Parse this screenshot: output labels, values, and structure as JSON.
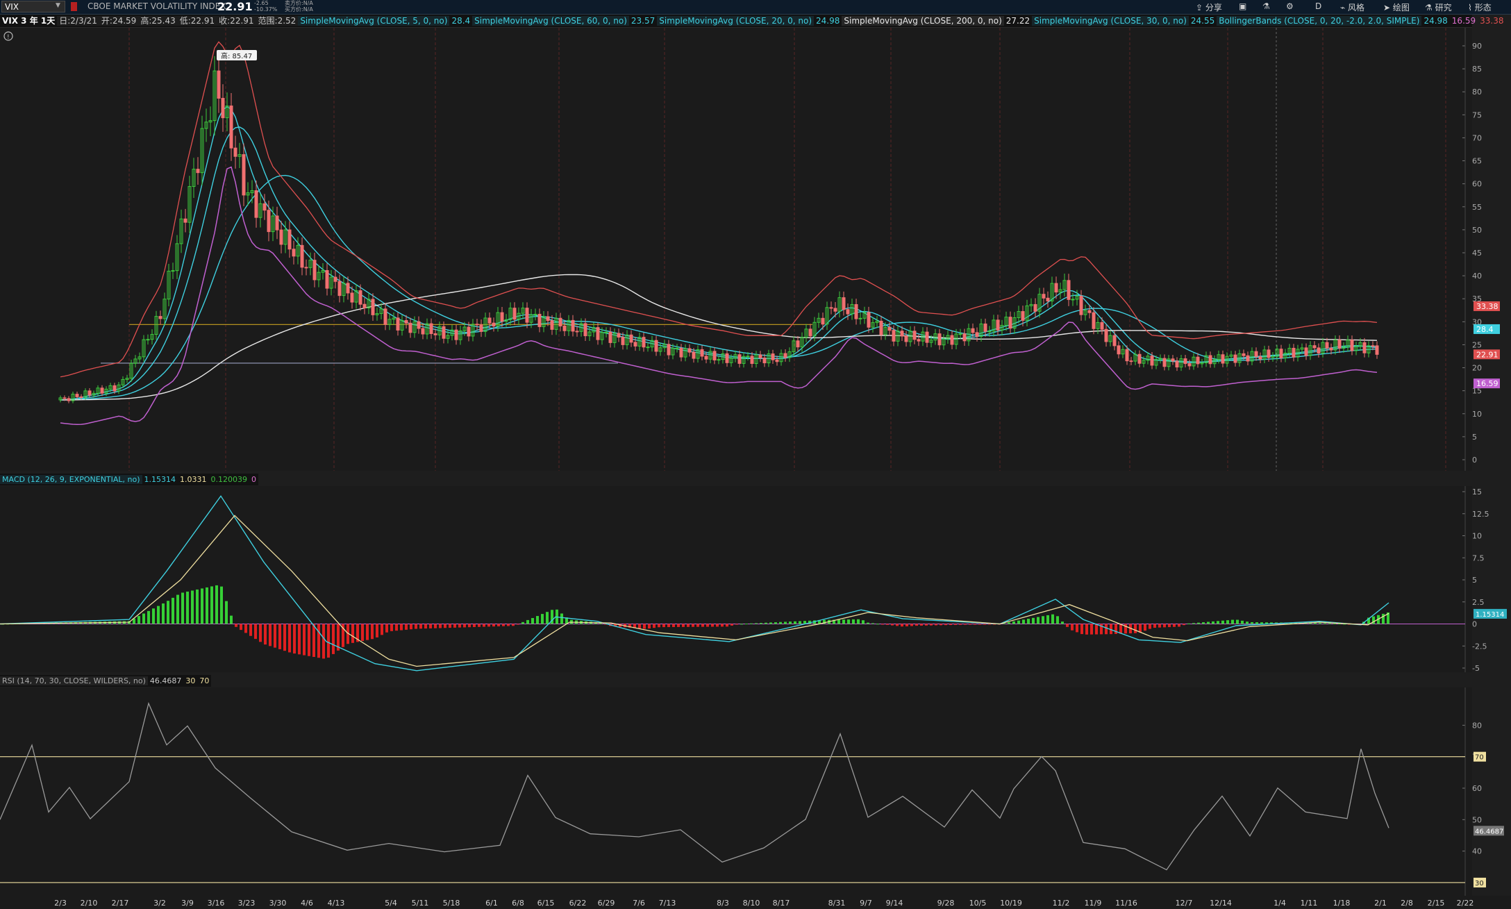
{
  "toolbar": {
    "symbol": "VIX",
    "name": "CBOE MARKET VOLATILITY INDEX",
    "last": "22.91",
    "change": "-2.65",
    "change_pct": "-10.37%",
    "bid": "卖方价:N/A",
    "ask": "买方价:N/A",
    "buttons": [
      "分享",
      "D",
      "风格",
      "绘图",
      "研究",
      "形态"
    ]
  },
  "study_header": {
    "period": "VIX 3 年 1天",
    "date": "日:2/3/21",
    "open": "开:24.59",
    "high": "高:25.43",
    "low": "低:22.91",
    "close": "收:22.91",
    "range": "范围:2.52",
    "studies": [
      {
        "label": "SimpleMovingAvg (CLOSE, 5, 0, no)",
        "value": "28.4",
        "color": "#3fd0e0"
      },
      {
        "label": "SimpleMovingAvg (CLOSE, 60, 0, no)",
        "value": "23.57",
        "color": "#3fd0e0"
      },
      {
        "label": "SimpleMovingAvg (CLOSE, 20, 0, no)",
        "value": "24.98",
        "color": "#3fd0e0"
      },
      {
        "label": "SimpleMovingAvg (CLOSE, 200, 0, no)",
        "value": "27.22",
        "color": "#e8e8e8"
      },
      {
        "label": "SimpleMovingAvg (CLOSE, 30, 0, no)",
        "value": "24.55",
        "color": "#3fd0e0"
      },
      {
        "label": "BollingerBands (CLOSE, 0, 20, -2.0, 2.0, SIMPLE)",
        "value": "24.98",
        "value2": "16.59",
        "value3": "33.38",
        "color": "#3fd0e0"
      }
    ]
  },
  "price_pane": {
    "high_marker": "高: 85.47",
    "y_ticks": [
      "90",
      "85",
      "80",
      "75",
      "70",
      "65",
      "60",
      "55",
      "50",
      "45",
      "40",
      "35",
      "30",
      "25",
      "20",
      "15",
      "10",
      "5",
      "0"
    ],
    "right_tags": [
      {
        "label": "33.38",
        "color": "#e05050"
      },
      {
        "label": "28.4",
        "color": "#3fd0e0"
      },
      {
        "label": "22.91",
        "color": "#e05050"
      },
      {
        "label": "16.59",
        "color": "#c060d0"
      }
    ]
  },
  "macd_pane": {
    "label": "MACD (12, 26, 9, EXPONENTIAL, no)",
    "value": "1.15314",
    "avg": "1.0331",
    "diff": "0.120039",
    "zero": "0",
    "y_ticks": [
      "15",
      "12.5",
      "10",
      "7.5",
      "5",
      "2.5",
      "0",
      "-2.5",
      "-5"
    ],
    "right_tag": "1.15314"
  },
  "rsi_pane": {
    "label": "RSI (14, 70, 30, CLOSE, WILDERS, no)",
    "value": "46.4687",
    "oversold": "30",
    "overbought": "70",
    "y_ticks": [
      "80",
      "70",
      "60",
      "50",
      "40"
    ],
    "right_tag": "46.4687"
  },
  "x_axis": [
    "2/3",
    "2/10",
    "2/17",
    "3/2",
    "3/9",
    "3/16",
    "3/23",
    "3/30",
    "4/6",
    "4/13",
    "5/4",
    "5/11",
    "5/18",
    "6/1",
    "6/8",
    "6/15",
    "6/22",
    "6/29",
    "7/6",
    "7/13",
    "8/3",
    "8/10",
    "8/17",
    "8/31",
    "9/7",
    "9/14",
    "9/28",
    "10/5",
    "10/19",
    "11/2",
    "11/9",
    "11/16",
    "12/7",
    "12/14",
    "1/4",
    "1/11",
    "1/18",
    "2/1",
    "2/8",
    "2/15",
    "2/22"
  ],
  "chart_data": {
    "type": "line",
    "title": "",
    "x": [
      "2/3",
      "2/17",
      "3/2",
      "3/16",
      "3/23",
      "4/6",
      "4/13",
      "5/4",
      "5/18",
      "6/8",
      "6/15",
      "6/29",
      "7/13",
      "8/3",
      "8/17",
      "8/31",
      "9/14",
      "9/28",
      "10/19",
      "11/2",
      "11/16",
      "12/7",
      "12/14",
      "1/4",
      "1/18",
      "2/1"
    ],
    "series": [
      {
        "values": [
          13,
          16,
          31,
          82,
          58,
          42,
          38,
          30,
          27,
          32,
          30,
          27,
          24,
          22,
          22,
          34,
          27,
          26,
          30,
          38,
          22,
          21,
          22,
          23,
          25,
          24
        ]
      }
    ],
    "ylim": [
      0,
      90
    ]
  }
}
